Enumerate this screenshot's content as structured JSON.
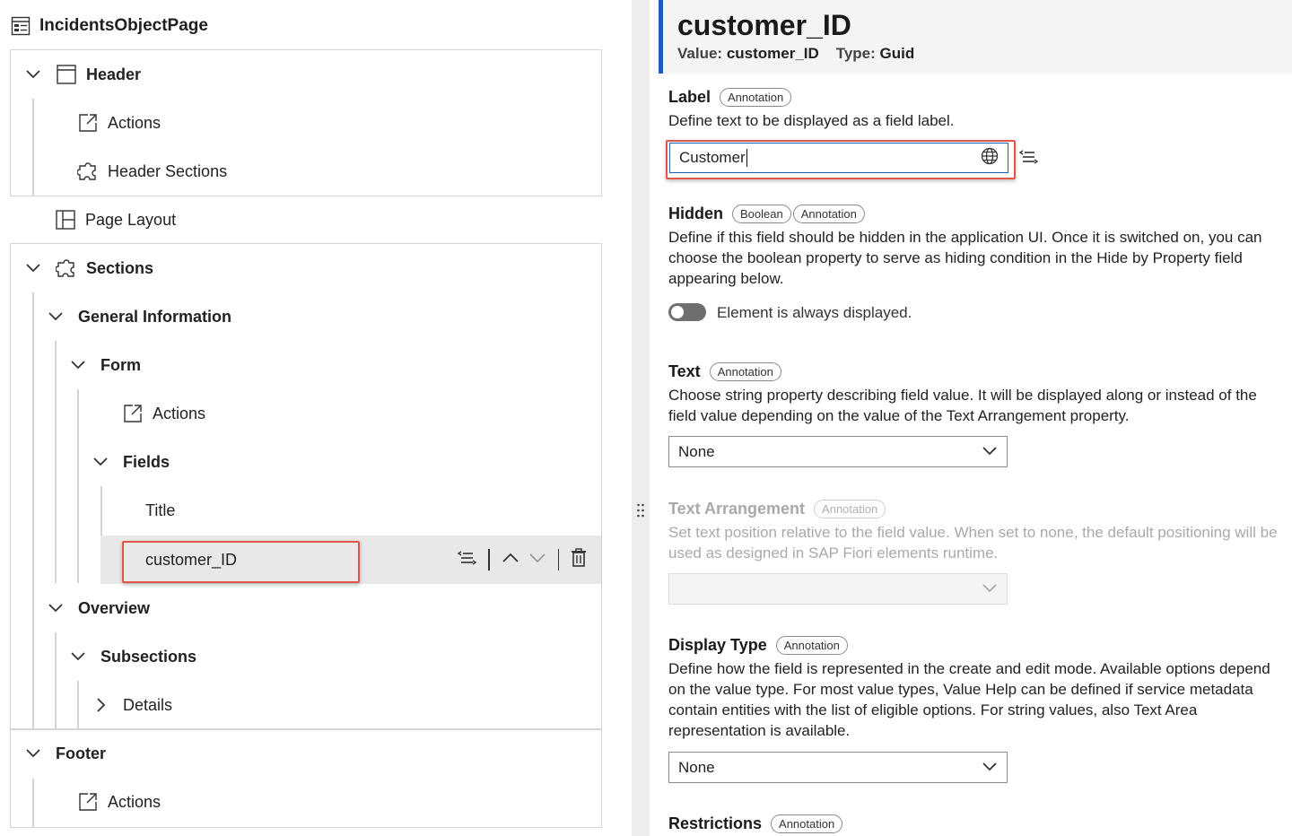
{
  "tree": {
    "root_label": "IncidentsObjectPage",
    "header": {
      "label": "Header",
      "actions": "Actions",
      "header_sections": "Header Sections"
    },
    "page_layout": "Page Layout",
    "sections": {
      "label": "Sections",
      "general_information": "General Information",
      "form": "Form",
      "form_actions": "Actions",
      "fields": "Fields",
      "field_title": "Title",
      "field_customer": "customer_ID",
      "overview": "Overview",
      "subsections": "Subsections",
      "details": "Details"
    },
    "footer": {
      "label": "Footer",
      "actions": "Actions"
    }
  },
  "properties": {
    "title": "customer_ID",
    "value_key": "Value:",
    "value": "customer_ID",
    "type_key": "Type:",
    "type": "Guid",
    "label": {
      "name": "Label",
      "chip": "Annotation",
      "desc": "Define text to be displayed as a field label.",
      "input_value": "Customer"
    },
    "hidden": {
      "name": "Hidden",
      "chip1": "Boolean",
      "chip2": "Annotation",
      "desc": "Define if this field should be hidden in the application UI. Once it is switched on, you can choose the boolean property to serve as hiding condition in the Hide by Property field appearing below.",
      "toggle_text": "Element is always displayed."
    },
    "text": {
      "name": "Text",
      "chip": "Annotation",
      "desc": "Choose string property describing field value. It will be displayed along or instead of the field value depending on the value of the Text Arrangement property.",
      "select_value": "None"
    },
    "text_arrangement": {
      "name": "Text Arrangement",
      "chip": "Annotation",
      "desc": "Set text position relative to the field value. When set to none, the default positioning will be used as designed in SAP Fiori elements runtime.",
      "select_value": ""
    },
    "display_type": {
      "name": "Display Type",
      "chip": "Annotation",
      "desc": "Define how the field is represented in the create and edit mode. Available options depend on the value type. For most value types, Value Help can be defined if service metadata contain entities with the list of eligible options. For string values, also Text Area representation is available.",
      "select_value": "None"
    },
    "restrictions": {
      "name": "Restrictions",
      "chip": "Annotation"
    }
  },
  "colors": {
    "accent": "#1f5eb8",
    "highlight": "#e0574a",
    "selected_row": "#e8e8e8"
  }
}
